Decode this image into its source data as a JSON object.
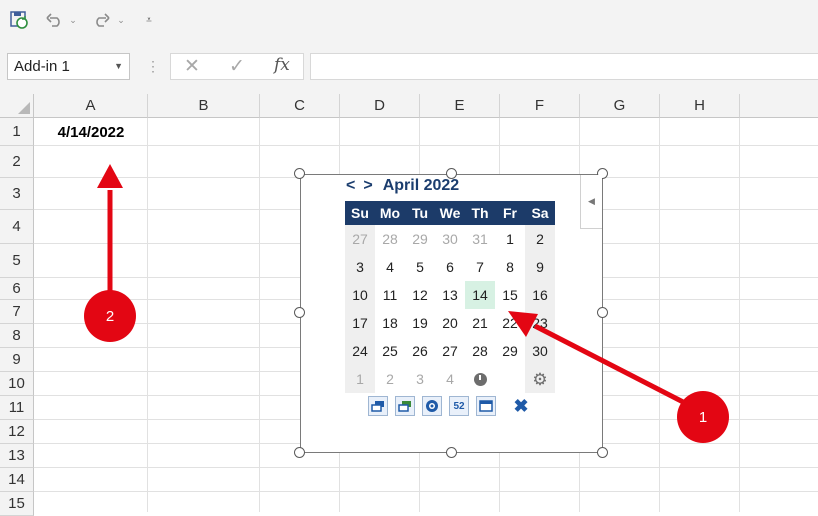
{
  "quick_access": {
    "save_icon": "save-refresh-icon",
    "undo_icon": "undo-icon",
    "redo_icon": "redo-icon",
    "customize_icon": "customize-toolbar-icon"
  },
  "name_box": {
    "value": "Add-in 1"
  },
  "formula_bar": {
    "cancel_symbol": "✕",
    "enter_symbol": "✓",
    "function_symbol": "fx",
    "value": ""
  },
  "sheet": {
    "columns": [
      "A",
      "B",
      "C",
      "D",
      "E",
      "F",
      "G",
      "H"
    ],
    "rows": [
      "1",
      "2",
      "3",
      "4",
      "5",
      "6",
      "7",
      "8",
      "9",
      "10",
      "11",
      "12",
      "13",
      "14",
      "15"
    ],
    "cell_a1": "4/14/2022"
  },
  "calendar": {
    "prev": "<",
    "next": ">",
    "month_label": "April 2022",
    "weekdays": [
      "Su",
      "Mo",
      "Tu",
      "We",
      "Th",
      "Fr",
      "Sa"
    ],
    "weeks": [
      [
        "27",
        "28",
        "29",
        "30",
        "31",
        "1",
        "2"
      ],
      [
        "3",
        "4",
        "5",
        "6",
        "7",
        "8",
        "9"
      ],
      [
        "10",
        "11",
        "12",
        "13",
        "14",
        "15",
        "16"
      ],
      [
        "17",
        "18",
        "19",
        "20",
        "21",
        "22",
        "23"
      ],
      [
        "24",
        "25",
        "26",
        "27",
        "28",
        "29",
        "30"
      ],
      [
        "1",
        "2",
        "3",
        "4",
        "",
        "",
        ""
      ]
    ],
    "selected_day": "14",
    "toolbar": {
      "buttons": [
        "restore-window-icon",
        "restore-window-green-icon",
        "info-globe-icon",
        "week-number-icon",
        "calendar-icon",
        "close-icon"
      ],
      "week_label": "52"
    }
  },
  "annotations": {
    "marker_1": "1",
    "marker_2": "2"
  },
  "colors": {
    "accent": "#1c3b69",
    "selected": "#d7f1e3",
    "marker": "#e30613"
  }
}
